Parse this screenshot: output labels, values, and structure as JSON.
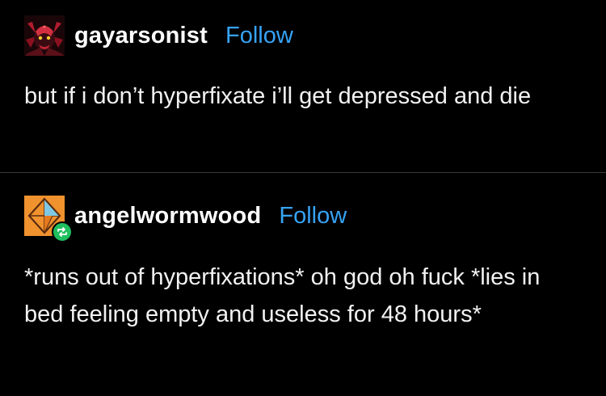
{
  "post_original": {
    "username": "gayarsonist",
    "follow_label": "Follow",
    "text": "but if i don’t hyperfixate i’ll get depressed and die"
  },
  "post_reblog": {
    "username": "angelwormwood",
    "follow_label": "Follow",
    "text": "*runs out of hyperfixations* oh god oh fuck *lies in bed feeling empty and useless for 48 hours*"
  },
  "icons": {
    "avatar_1": "demon-avatar-icon",
    "avatar_2": "diamond-avatar-icon",
    "reblog": "reblog-icon"
  },
  "colors": {
    "background": "#000000",
    "text": "#ffffff",
    "link": "#36a3f5",
    "reblog_badge": "#1fbf5f",
    "avatar_2_bg": "#f0922e",
    "divider": "#3a3a3a"
  }
}
